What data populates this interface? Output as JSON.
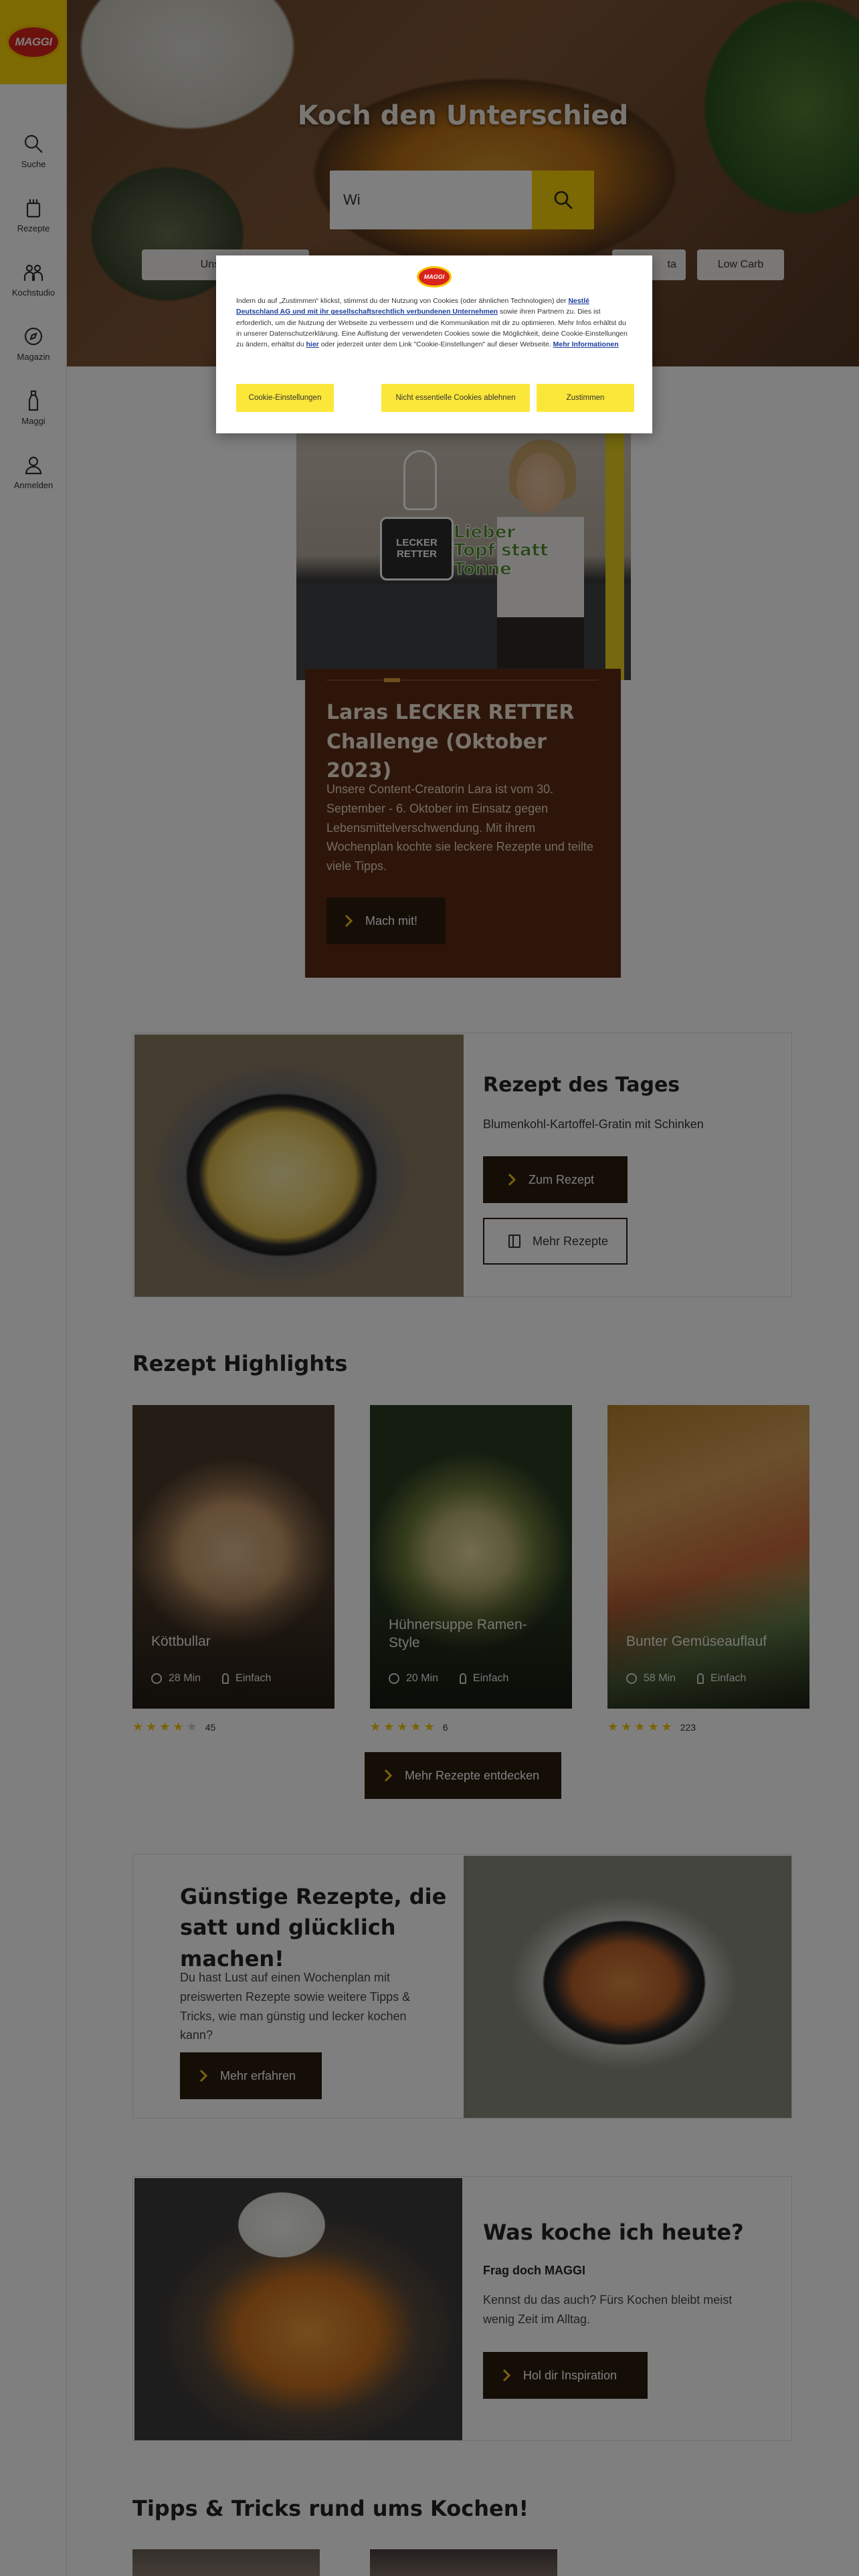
{
  "brand": {
    "logo_text": "MAGGI"
  },
  "sidebar": {
    "items": [
      {
        "label": "Suche",
        "icon": "search-icon"
      },
      {
        "label": "Rezepte",
        "icon": "recipe-book-icon"
      },
      {
        "label": "Kochstudio",
        "icon": "kochstudio-people-icon"
      },
      {
        "label": "Magazin",
        "icon": "compass-icon"
      },
      {
        "label": "Maggi",
        "icon": "maggi-bottle-icon"
      },
      {
        "label": "Anmelden",
        "icon": "user-icon"
      }
    ]
  },
  "hero": {
    "title": "Koch den Unterschied",
    "search_value": "Wi",
    "chips": [
      "Unsere Fo",
      "ta",
      "Low Carb"
    ]
  },
  "challenge": {
    "image_title_top": "LECKER RETTER",
    "image_slogan": "Lieber Topf statt Tonne",
    "title": "Laras LECKER RETTER Challenge (Oktober 2023)",
    "text": "Unsere Content-Creatorin Lara ist vom 30. September - 6. Oktober im Einsatz gegen Lebensmittelverschwendung. Mit ihrem Wochenplan kochte sie leckere Rezepte und teilte viele Tipps.",
    "button": "Mach mit!"
  },
  "recipe_of_day": {
    "title": "Rezept des Tages",
    "subtitle": "Blumenkohl-Kartoffel-Gratin mit Schinken",
    "primary_button": "Zum Rezept",
    "secondary_button": "Mehr Rezepte"
  },
  "highlights": {
    "title": "Rezept Highlights",
    "cards": [
      {
        "name": "Köttbullar",
        "time": "28 Min",
        "difficulty": "Einfach",
        "rating": 4,
        "count": "45"
      },
      {
        "name": "Hühnersuppe Ramen-Style",
        "time": "20 Min",
        "difficulty": "Einfach",
        "rating": 5,
        "count": "6"
      },
      {
        "name": "Bunter Gemüseauflauf",
        "time": "58 Min",
        "difficulty": "Einfach",
        "rating": 5,
        "count": "223"
      }
    ],
    "more_button": "Mehr Rezepte entdecken"
  },
  "budget": {
    "title": "Günstige Rezepte, die satt und glücklich machen!",
    "text": "Du hast Lust auf einen Wochenplan mit preiswerten Rezepte sowie weitere Tipps & Tricks, wie man günstig und lecker kochen kann?",
    "button": "Mehr erfahren"
  },
  "what_to_cook": {
    "title": "Was koche ich heute?",
    "subtitle": "Frag doch MAGGI",
    "text": "Kennst du das auch? Fürs Kochen bleibt meist wenig Zeit im Alltag.",
    "button": "Hol dir Inspiration"
  },
  "tips": {
    "title": "Tipps & Tricks rund ums Kochen!"
  },
  "cookie": {
    "logo_text": "MAGGI",
    "text_1": "Indem du auf „Zustimmen“ klickst, stimmst du der Nutzung von Cookies (oder ähnlichen Technologien) der ",
    "link_1": "Nestlé Deutschland AG und mit ihr gesellschaftsrechtlich verbundenen Unternehmen",
    "text_2": " sowie ihren Partnern zu. Dies ist erforderlich, um die Nutzung der Webseite zu verbessern und die Kommunikation mit dir zu optimieren. Mehr Infos erhältst du in unserer Datenschutzerklärung. Eine Auflistung der verwendeten Cookies sowie die Möglichkeit, deine Cookie-Einstellungen zu ändern, erhältst du ",
    "link_2": "hier",
    "text_3": " oder jederzeit unter dem Link \"Cookie-Einstellungen\" auf dieser Webseite. ",
    "link_3": "Mehr Informationen",
    "btn_settings": "Cookie-Einstellungen",
    "btn_reject": "Nicht essentielle Cookies ablehnen",
    "btn_accept": "Zustimmen"
  }
}
